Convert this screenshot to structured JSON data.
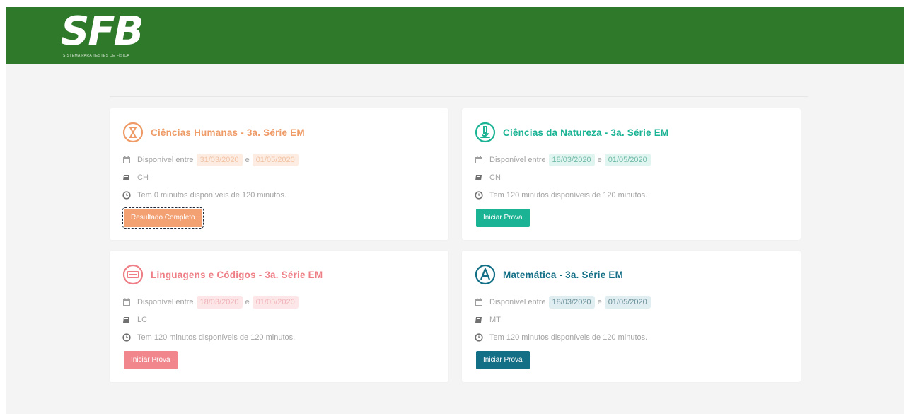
{
  "header": {
    "logo_text": "SFB",
    "logo_tagline": "SISTEMA PARA TESTES DE FÍSICA",
    "color": "#2e7a2a"
  },
  "cards": [
    {
      "title": "Ciências Humanas - 3a. Série EM",
      "icon": "hourglass-icon",
      "color": "#ef9b67",
      "available_label": "Disponível entre",
      "start_date": "31/03/2020",
      "connector": "e",
      "end_date": "01/05/2020",
      "date_pill_bg": "#fdece2",
      "area_code": "CH",
      "time_text": "Tem 0 minutos disponíveis de 120 minutos.",
      "button_label": "Resultado Completo"
    },
    {
      "title": "Ciências da Natureza - 3a. Série EM",
      "icon": "microscope-icon",
      "color": "#1ab394",
      "available_label": "Disponível entre",
      "start_date": "18/03/2020",
      "connector": "e",
      "end_date": "01/05/2020",
      "date_pill_bg": "#e1f5f0",
      "area_code": "CN",
      "time_text": "Tem 120 minutos disponíveis de 120 minutos.",
      "button_label": "Iniciar Prova"
    },
    {
      "title": "Linguagens e Códigos - 3a. Série EM",
      "icon": "keyboard-icon",
      "color": "#ef7f87",
      "available_label": "Disponível entre",
      "start_date": "18/03/2020",
      "connector": "e",
      "end_date": "01/05/2020",
      "date_pill_bg": "#fde6e8",
      "area_code": "LC",
      "time_text": "Tem 120 minutos disponíveis de 120 minutos.",
      "button_label": "Iniciar Prova"
    },
    {
      "title": "Matemática - 3a. Série EM",
      "icon": "letter-a-icon",
      "color": "#136f86",
      "available_label": "Disponível entre",
      "start_date": "18/03/2020",
      "connector": "e",
      "end_date": "01/05/2020",
      "date_pill_bg": "#e0eef1",
      "area_code": "MT",
      "time_text": "Tem 120 minutos disponíveis de 120 minutos.",
      "button_label": "Iniciar Prova"
    }
  ]
}
